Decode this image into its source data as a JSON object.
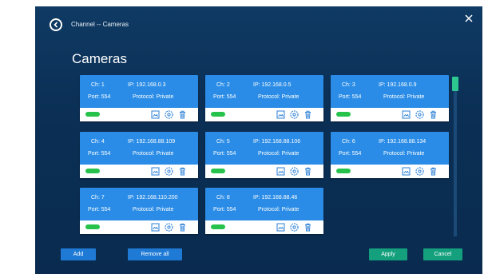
{
  "header": {
    "breadcrumb": "Channel -- Cameras",
    "title": "Cameras"
  },
  "cameras": [
    {
      "ch": "Ch:  1",
      "ip": "IP: 192.168.0.3",
      "port": "Port:  554",
      "protocol": "Protocol: Private"
    },
    {
      "ch": "Ch:  2",
      "ip": "IP: 192.168.0.5",
      "port": "Port:  554",
      "protocol": "Protocol: Private"
    },
    {
      "ch": "Ch:  3",
      "ip": "IP: 192.168.0.9",
      "port": "Port:  554",
      "protocol": "Protocol: Private"
    },
    {
      "ch": "Ch:  4",
      "ip": "IP: 192.168.88.109",
      "port": "Port:  554",
      "protocol": "Protocol: Private"
    },
    {
      "ch": "Ch:  5",
      "ip": "IP: 192.168.88.106",
      "port": "Port:  554",
      "protocol": "Protocol: Private"
    },
    {
      "ch": "Ch:  6",
      "ip": "IP: 192.168.88.134",
      "port": "Port:  554",
      "protocol": "Protocol: Private"
    },
    {
      "ch": "Ch:  7",
      "ip": "IP: 192.168.110.200",
      "port": "Port:  554",
      "protocol": "Protocol: Private"
    },
    {
      "ch": "Ch:  8",
      "ip": "IP: 192.168.88.46",
      "port": "Port:  554",
      "protocol": "Protocol: Private"
    }
  ],
  "buttons": {
    "add": "Add",
    "remove_all": "Remove all",
    "apply": "Apply",
    "cancel": "Cancel"
  },
  "colors": {
    "panel": "#0b2f55",
    "card": "#2a8ce6",
    "status_ok": "#27c24c",
    "primary_button": "#1f7ad6",
    "confirm_button": "#14a07d"
  }
}
